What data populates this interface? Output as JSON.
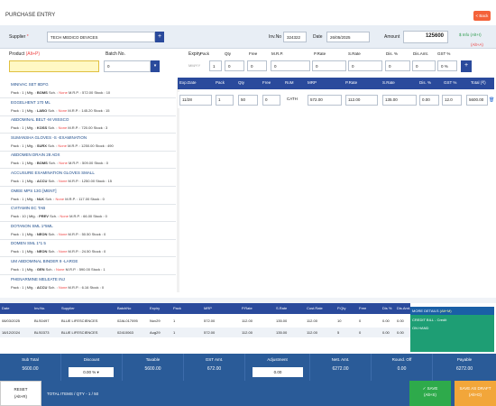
{
  "title": "PURCHASE ENTRY",
  "back_label": "< Back",
  "supplier": {
    "label": "Supplier",
    "req": "*",
    "value": "TECH MEDICO DEVICES"
  },
  "invno": {
    "label": "Inv.No",
    "value": "324322"
  },
  "date": {
    "label": "Date",
    "value": "26/05/2025"
  },
  "amount": {
    "label": "Amount",
    "value": "125600"
  },
  "info_label": "$ Info (Alt+I)",
  "alt_a": "(Alt+A)",
  "product": {
    "label": "Product",
    "hint": "(Alt+P)",
    "value": ""
  },
  "batch": {
    "label": "Batch No.",
    "value": "0"
  },
  "expiry": {
    "label": "Expiry",
    "placeholder": "MM/YY"
  },
  "cols": {
    "pack": "Pack",
    "qty": "Qty",
    "free": "Free",
    "mrp": "M.R.P.",
    "prate": "P.Rate",
    "srate": "S.Rate",
    "dis": "Dis. %",
    "disamt": "Dis.Amt.",
    "gst": "GST %"
  },
  "entry_values": {
    "pack": "1",
    "qty": "0",
    "free": "0",
    "mrp": "0",
    "prate": "0",
    "srate": "0",
    "dis": "0",
    "disamt": "0",
    "gst": "0 %"
  },
  "dropdown": [
    {
      "name": "MINIVAC SET 8DFG",
      "pack": "1",
      "mfg": "BOMS",
      "sch": "None",
      "mrp": "572.00",
      "stock": "10"
    },
    {
      "name": "EGGELHENT 170 ML",
      "pack": "1",
      "mfg": "LABO",
      "sch": "None",
      "mrp": "145.20",
      "stock": "15"
    },
    {
      "name": "ABDOMINAL BELT -M V8SSCO",
      "pack": "1",
      "mfg": "KOSS",
      "sch": "None",
      "mrp": "720.00",
      "stock": "3"
    },
    {
      "name": "SUMANSHA GLOVES -S -EXAMINATION",
      "pack": "1",
      "mfg": "SURX",
      "sch": "None",
      "mrp": "1250.00",
      "stock": "490"
    },
    {
      "name": "ABDOMEN DRAIN 28 ADX",
      "pack": "1",
      "mfg": "BOMS",
      "sch": "None",
      "mrp": "509.00",
      "stock": "0"
    },
    {
      "name": "ACCUSURE EXAMINATION GLOVES SMALL",
      "pack": "1",
      "mfg": "ACCU",
      "sch": "None",
      "mrp": "1250.00",
      "stock": "15"
    },
    {
      "name": "OMEE MPS 13G [MENT]",
      "pack": "1",
      "mfg": "NLK",
      "sch": "None",
      "mrp": "117.00",
      "stock": "0"
    },
    {
      "name": "CVITAMIN EC TAB",
      "pack": "10",
      "mfg": "PREV",
      "sch": "None",
      "mrp": "66.00",
      "stock": "0"
    },
    {
      "name": "DOTANON SML 1*5ML",
      "pack": "1",
      "mfg": "NEON",
      "sch": "None",
      "mrp": "50.50",
      "stock": "0"
    },
    {
      "name": "DOMEN SML 1*1 5",
      "pack": "1",
      "mfg": "NEON",
      "sch": "None",
      "mrp": "24.50",
      "stock": "0"
    },
    {
      "name": "UM ABDOMINAL BINDER 9 -LARGE",
      "pack": "1",
      "mfg": "GEN",
      "sch": "None",
      "mrp": "590.00",
      "stock": "1"
    },
    {
      "name": "PHENARMINE MELEATE INJ",
      "pack": "1",
      "mfg": "ACCU",
      "sch": "None",
      "mrp": "6.16",
      "stock": "0"
    }
  ],
  "grid_head": [
    "Exp.Date",
    "Pack",
    "Qty",
    "Free",
    "RoM",
    "MRP",
    "P.Rate",
    "S.Rate",
    "Dis. %",
    "GST %",
    "Total (₹)"
  ],
  "grid_row": [
    "11/28",
    "1",
    "50",
    "0",
    "CATH",
    "572.00",
    "112.00",
    "135.00",
    "0.00",
    "12.0",
    "5600.00"
  ],
  "bottom_head": [
    "Date",
    "Inv.No.",
    "Supplier",
    "BatchNo",
    "Expiry",
    "Pack",
    "MRP",
    "P.Rate",
    "S.Rate",
    "Cost.Rate",
    "P.Qty",
    "Free",
    "Dis %",
    "Dis.Amt."
  ],
  "bottom_rows": [
    [
      "08/03/2025",
      "BLS0497",
      "BLUE LIFESCIENCES",
      "02AL017095",
      "Nov29",
      "1",
      "572.00",
      "112.00",
      "135.00",
      "112.00",
      "10",
      "0",
      "0.00",
      "0.00"
    ],
    [
      "18/12/2024",
      "BLS0373",
      "BLUE LIFESCIENCES",
      "02410063",
      "Aug29",
      "1",
      "572.00",
      "112.00",
      "135.00",
      "112.00",
      "5",
      "0",
      "0.00",
      "0.00"
    ]
  ],
  "more": {
    "title": "MORE DETAILS",
    "alt": "(Alt+M)",
    "credit": "CREDIT BILL - Credit",
    "onhand": "ON HAND"
  },
  "totals": {
    "subtotal": {
      "label": "Sub Total",
      "value": "5600.00"
    },
    "discount": {
      "label": "Discount",
      "value": "0.00",
      "unit": "%"
    },
    "taxable": {
      "label": "Taxable",
      "value": "5600.00"
    },
    "gst": {
      "label": "GST Amt.",
      "value": "672.00"
    },
    "adjustment": {
      "label": "Adjustment",
      "value": "0.00"
    },
    "nett": {
      "label": "Nett. Amt.",
      "value": "6272.00"
    },
    "roundoff": {
      "label": "Round. Off",
      "value": "0.00"
    },
    "payable": {
      "label": "Payable",
      "value": "6272.00"
    }
  },
  "footer": {
    "reset": "RESET",
    "reset_alt": "(Alt+R)",
    "total_items": "TOTAL ITEMS / QTY - 1 / 50",
    "save": "✓ SAVE",
    "save_alt": "(Alt+S)",
    "draft": "SAVE AS DRAFT",
    "draft_alt": "(Alt+D)"
  }
}
